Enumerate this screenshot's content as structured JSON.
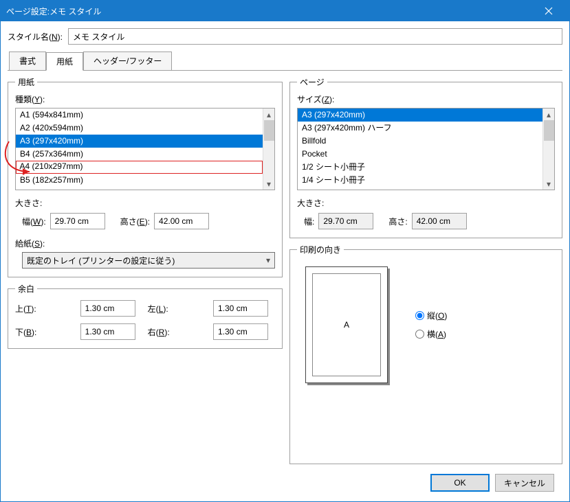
{
  "window_title": "ページ設定:メモ スタイル",
  "style_name_label": "スタイル名(N):",
  "style_name_value": "メモ スタイル",
  "tabs": {
    "format": "書式",
    "paper": "用紙",
    "headerfooter": "ヘッダー/フッター"
  },
  "paper": {
    "legend": "用紙",
    "type_label": "種類(Y):",
    "items": [
      "A1 (594x841mm)",
      "A2 (420x594mm)",
      "A3 (297x420mm)",
      "B4 (257x364mm)",
      "A4 (210x297mm)",
      "B5 (182x257mm)"
    ],
    "size_label": "大きさ:",
    "width_label": "幅(W):",
    "width_value": "29.70 cm",
    "height_label": "高さ(E):",
    "height_value": "42.00 cm",
    "source_label": "給紙(S):",
    "source_value": "既定のトレイ (プリンターの設定に従う)"
  },
  "page": {
    "legend": "ページ",
    "size_label": "サイズ(Z):",
    "items": [
      "A3 (297x420mm)",
      "A3 (297x420mm) ハーフ",
      "Billfold",
      "Pocket",
      "1/2 シート小冊子",
      "1/4 シート小冊子"
    ],
    "size_text": "大きさ:",
    "width_label": "幅:",
    "width_value": "29.70 cm",
    "height_label": "高さ:",
    "height_value": "42.00 cm"
  },
  "margins": {
    "legend": "余白",
    "top_label": "上(T):",
    "top_value": "1.30 cm",
    "bottom_label": "下(B):",
    "bottom_value": "1.30 cm",
    "left_label": "左(L):",
    "left_value": "1.30 cm",
    "right_label": "右(R):",
    "right_value": "1.30 cm"
  },
  "orientation": {
    "legend": "印刷の向き",
    "preview_letter": "A",
    "portrait_label": "縦(O)",
    "landscape_label": "横(A)"
  },
  "buttons": {
    "ok": "OK",
    "cancel": "キャンセル"
  }
}
